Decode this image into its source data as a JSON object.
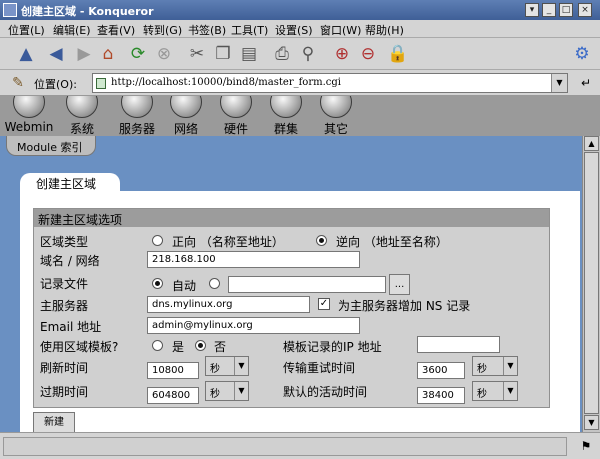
{
  "window": {
    "title": "创建主区域 - Konqueror"
  },
  "menu": [
    "位置(L)",
    "编辑(E)",
    "查看(V)",
    "转到(G)",
    "书签(B)",
    "工具(T)",
    "设置(S)",
    "窗口(W)",
    "帮助(H)"
  ],
  "location": {
    "label": "位置(O):",
    "url": "http://localhost:10000/bind8/master_form.cgi"
  },
  "webmin_categories": [
    "Webmin",
    "系统",
    "服务器",
    "网络",
    "硬件",
    "群集",
    "其它"
  ],
  "module_tab": "Module 索引",
  "page_tab": "创建主区域",
  "form": {
    "header": "新建主区域选项",
    "zone_type": {
      "label": "区域类型",
      "opt_forward": "正向 （名称至地址）",
      "opt_reverse": "逆向 （地址至名称）",
      "selected": "reverse"
    },
    "domain": {
      "label": "域名 / 网络",
      "value": "218.168.100"
    },
    "records_file": {
      "label": "记录文件",
      "opt_auto": "自动",
      "browse": "...",
      "value": ""
    },
    "master_server": {
      "label": "主服务器",
      "value": "dns.mylinux.org",
      "ns_label": "为主服务器增加 NS 记录",
      "ns_checked": true
    },
    "email": {
      "label": "Email 地址",
      "value": "admin@mylinux.org"
    },
    "template": {
      "label": "使用区域模板?",
      "opt_yes": "是",
      "opt_no": "否",
      "selected": "no",
      "ip_label": "模板记录的IP 地址",
      "ip_value": ""
    },
    "refresh": {
      "label": "刷新时间",
      "value": "10800",
      "unit": "秒"
    },
    "retry": {
      "label": "传输重试时间",
      "value": "3600",
      "unit": "秒"
    },
    "expiry": {
      "label": "过期时间",
      "value": "604800",
      "unit": "秒"
    },
    "default_ttl": {
      "label": "默认的活动时间",
      "value": "38400",
      "unit": "秒"
    },
    "create_button": "新建"
  },
  "colors": {
    "titlebar": "#4a6aa5",
    "content_bg": "#6a90c2",
    "form_header": "#9c9c9c"
  }
}
